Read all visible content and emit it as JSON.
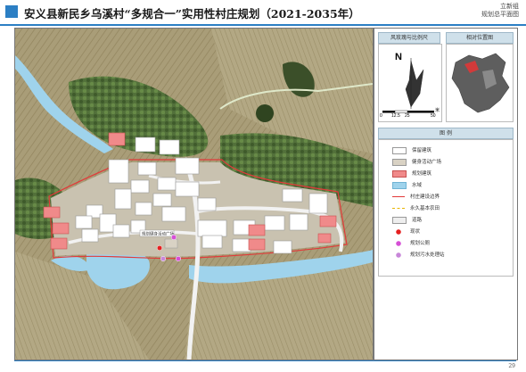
{
  "header": {
    "title": "安义县新民乡乌溪村“多规合一”实用性村庄规划（2021-2035年）",
    "subtitle_top": "立新组",
    "subtitle_bottom": "规划总平面图"
  },
  "compass": {
    "panel_title": "风玫瑰与比例尺",
    "north_label": "N",
    "scale_labels": [
      "0",
      "12.5",
      "25",
      "50"
    ],
    "scale_unit": "米"
  },
  "location_map": {
    "panel_title": "相对位置图"
  },
  "legend": {
    "panel_title": "图 例",
    "items": [
      {
        "label": "保留建筑",
        "kind": "box",
        "color": "#ffffff",
        "border": "#888888"
      },
      {
        "label": "健身活动广场",
        "kind": "box",
        "color": "#d9d2c4",
        "border": "#999999"
      },
      {
        "label": "规划建筑",
        "kind": "box",
        "color": "#f08a8a",
        "border": "#c85050"
      },
      {
        "label": "水域",
        "kind": "box",
        "color": "#9fd3ec",
        "border": "#6fb3d4"
      },
      {
        "label": "村庄建设边界",
        "kind": "line",
        "color": "#e23a3a"
      },
      {
        "label": "永久基本农田",
        "kind": "line-dash",
        "color": "#e8b400"
      },
      {
        "label": "道路",
        "kind": "box",
        "color": "#eeeeee",
        "border": "#aaaaaa"
      },
      {
        "label": "现状",
        "kind": "dot",
        "color": "#e52020"
      },
      {
        "label": "规划公厕",
        "kind": "dot",
        "color": "#d64fd6"
      },
      {
        "label": "规划污水处理站",
        "kind": "dot",
        "color": "#c887d9"
      }
    ]
  },
  "map_labels": {
    "plaza_label": "规划健身活动广场"
  },
  "footer": {
    "page_number": "29"
  },
  "colors": {
    "accent": "#2c7fc4",
    "field": "#a89a72",
    "forest": "#4f6b35",
    "water": "#9fd3ec",
    "road": "#f2f2f2",
    "planned_building": "#f08a8a"
  }
}
